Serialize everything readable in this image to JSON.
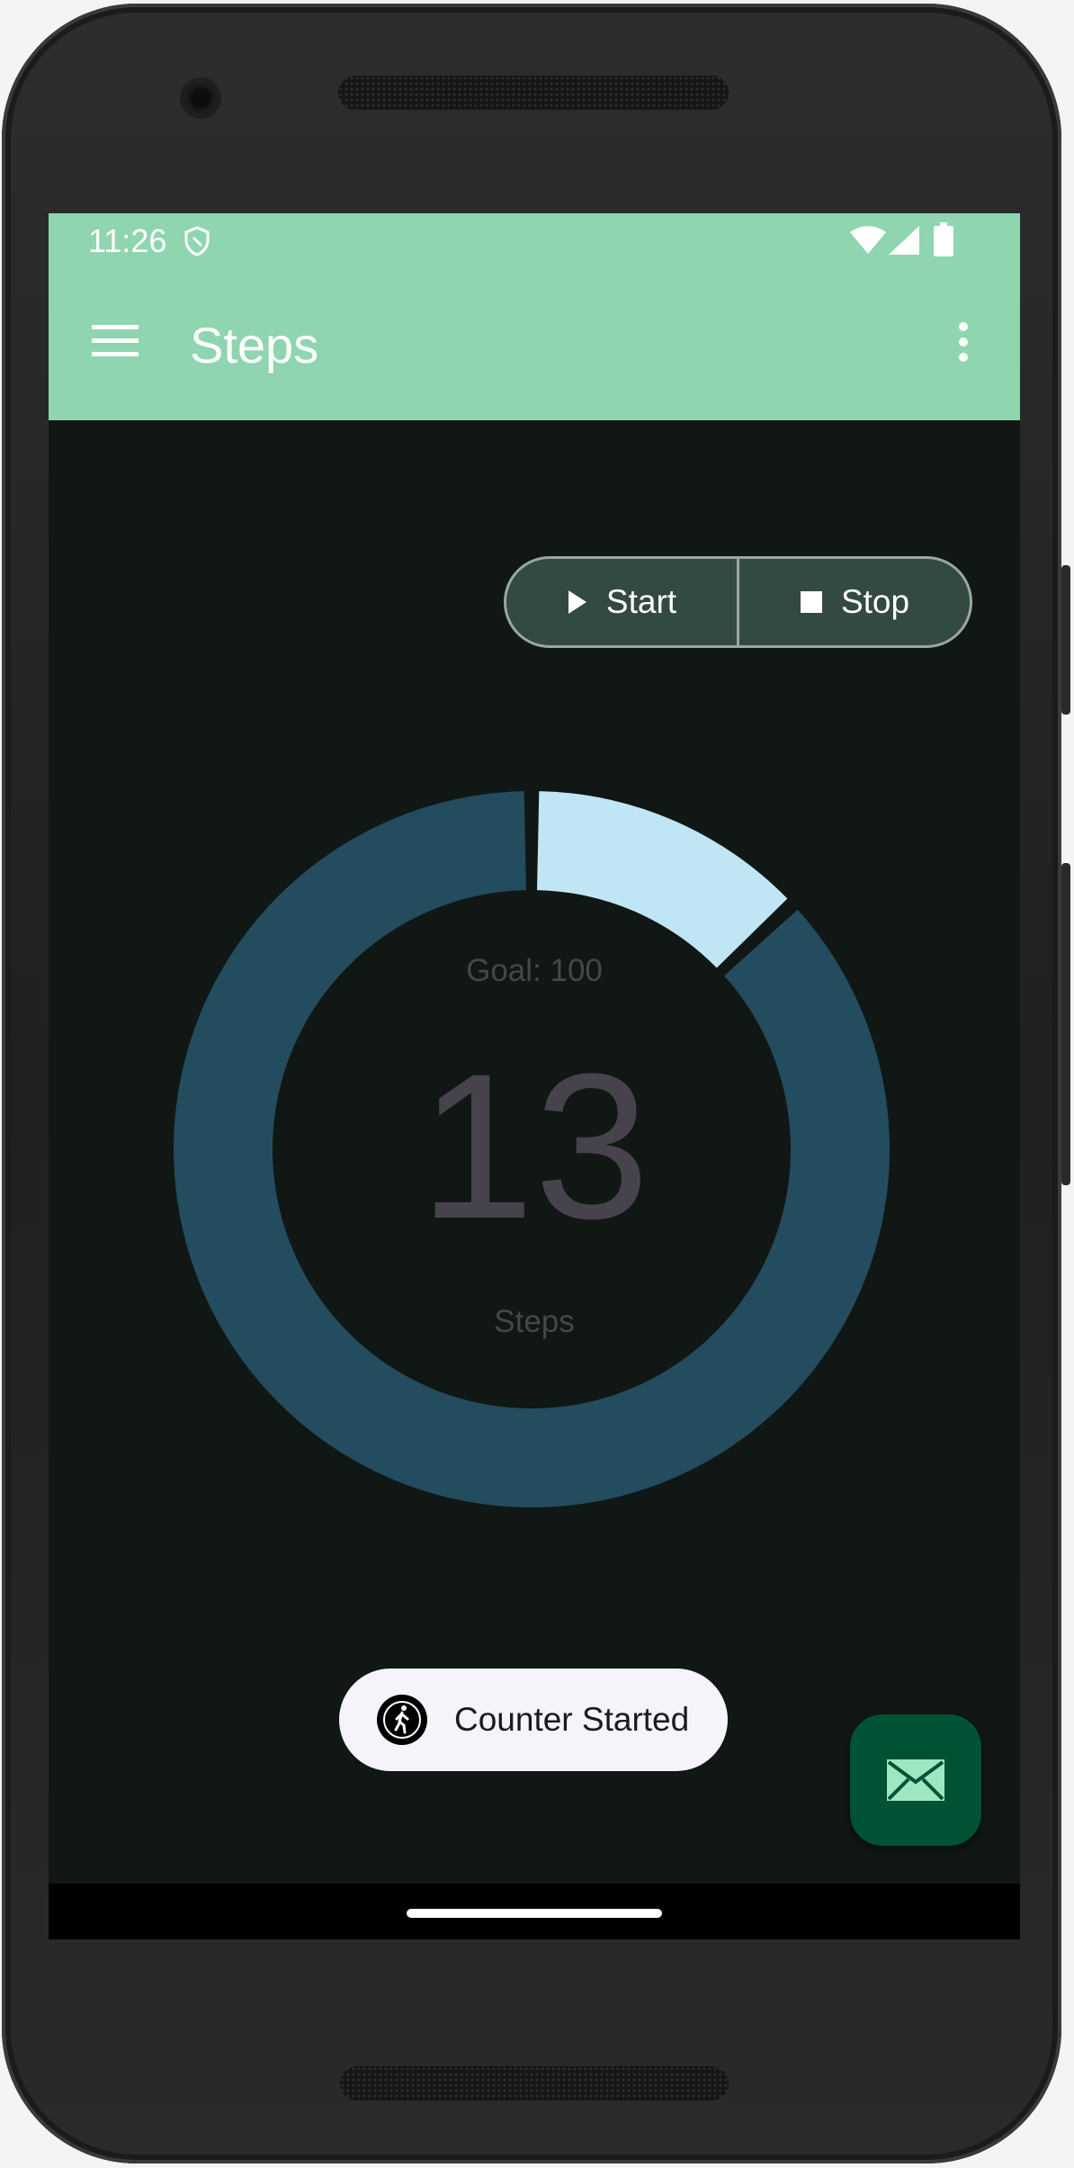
{
  "status_bar": {
    "time": "11:26",
    "icons": [
      "shield-icon",
      "wifi-icon",
      "signal-icon",
      "battery-icon"
    ]
  },
  "app_bar": {
    "title": "Steps",
    "icons": [
      "menu-icon",
      "overflow-menu-icon"
    ],
    "color": "#8fd5b0"
  },
  "controls": {
    "start_label": "Start",
    "stop_label": "Stop"
  },
  "progress": {
    "goal_label": "Goal: 100",
    "goal": 100,
    "count": "13",
    "steps_value": 13,
    "unit_label": "Steps",
    "fraction": 0.13,
    "ring_color": "#234c5e",
    "progress_color": "#c0e6f6"
  },
  "toast": {
    "message": "Counter Started",
    "icon": "walking-person-icon"
  },
  "fab": {
    "icon": "mail-icon",
    "color": "#005234"
  }
}
